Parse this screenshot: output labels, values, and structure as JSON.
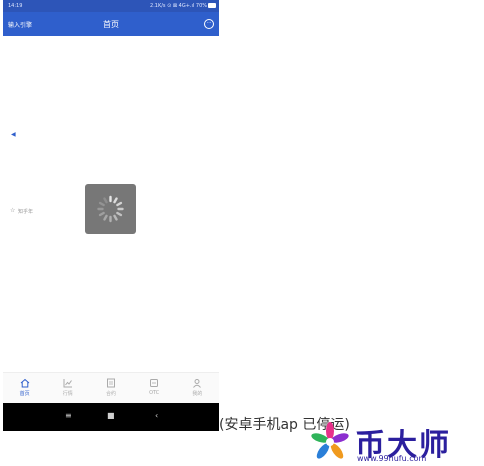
{
  "status_bar": {
    "time": "14:19",
    "system_info": "2.1K/s ⊙ ⊠ 4G+.ıl 70%"
  },
  "header": {
    "left_label": "输入引擎",
    "title": "首页"
  },
  "content": {
    "star_label": "知乎年"
  },
  "tab_bar": {
    "items": [
      {
        "label": "首页",
        "icon": "home-icon"
      },
      {
        "label": "行情",
        "icon": "chart-icon"
      },
      {
        "label": "合约",
        "icon": "contract-icon"
      },
      {
        "label": "OTC",
        "icon": "otc-icon"
      },
      {
        "label": "我的",
        "icon": "profile-icon"
      }
    ]
  },
  "watermark": {
    "caption": "(安卓手机ap      已停运)",
    "brand": "币大师",
    "url": "www.99hufu.com"
  },
  "colors": {
    "primary": "#2f5fcc",
    "status_bar": "#2d55b8",
    "loader": "#777777",
    "brand": "#2b1f9e"
  }
}
